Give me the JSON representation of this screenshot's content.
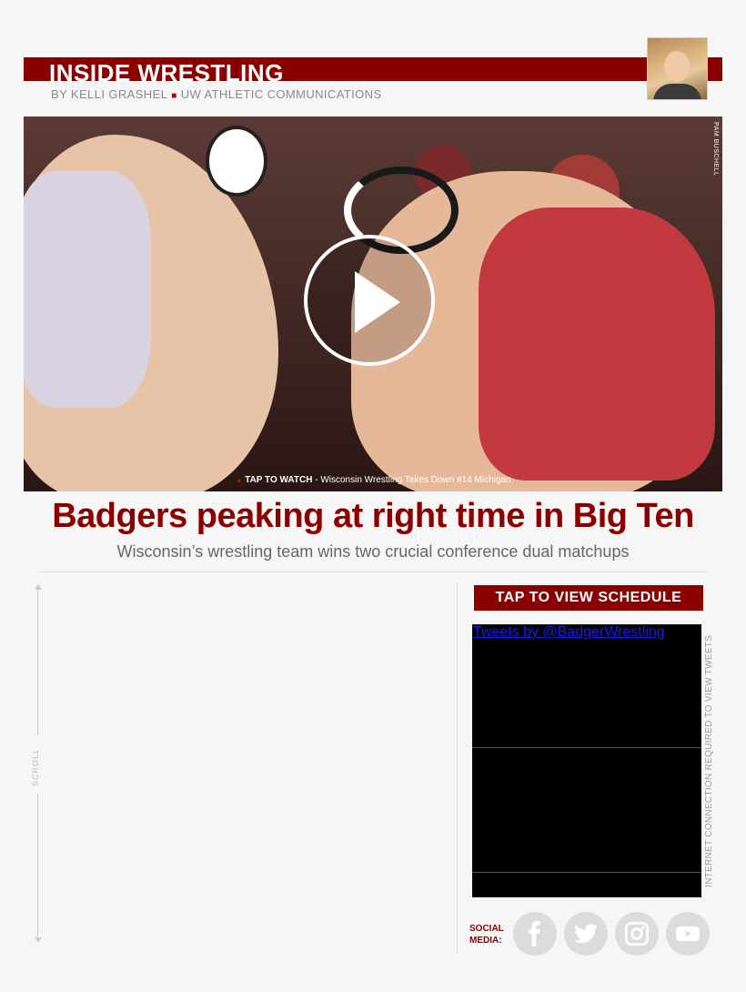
{
  "header": {
    "title": "INSIDE WRESTLING",
    "author": "BY KELLI GRASHEL",
    "separator": "■",
    "org": "UW ATHLETIC COMMUNICATIONS"
  },
  "hero": {
    "photo_credit": "PAM BUSCHELL",
    "caption_lead": "TAP TO WATCH",
    "caption_text": " - Wisconsin Wrestling Takes Down #14 Michigan",
    "caption_marker": "▲"
  },
  "article": {
    "headline": "Badgers peaking at right time in Big Ten",
    "subhead": "Wisconsin’s wrestling team wins two crucial conference dual matchups"
  },
  "sidebar": {
    "scroll_label": "SCROLL",
    "schedule_button": "TAP TO VIEW SCHEDULE",
    "tweets_link": "Tweets by @BadgerWrestling",
    "tweets_note": "INTERNET CONNECTION REQUIRED TO VIEW TWEETS",
    "social_label_line1": "SOCIAL",
    "social_label_line2": "MEDIA:",
    "social_icons": [
      "facebook-icon",
      "twitter-icon",
      "instagram-icon",
      "youtube-icon"
    ]
  },
  "colors": {
    "brand": "#8a0000",
    "background": "#f6f6f6"
  }
}
